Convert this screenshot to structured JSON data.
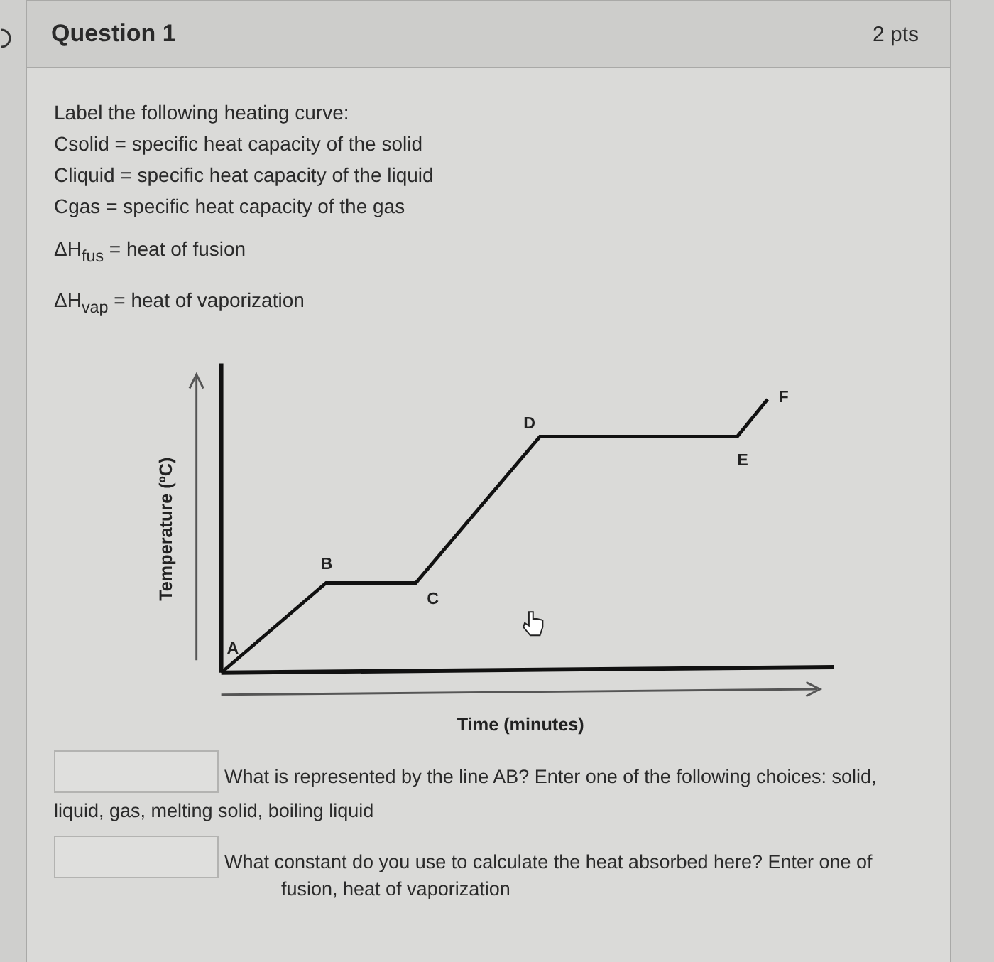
{
  "question": {
    "title": "Question 1",
    "points": "2 pts"
  },
  "intro_lines": [
    "Label the following heating curve:",
    "Csolid = specific heat capacity of the solid",
    "Cliquid = specific heat capacity of the liquid",
    "Cgas = specific heat capacity of the gas"
  ],
  "definitions": [
    "ΔH$_{fus}$ = heat of fusion",
    "ΔH$_{vap}$ = heat of vaporization"
  ],
  "diagram": {
    "y_axis_label": "Temperature (ºC)",
    "x_axis_label": "Time (minutes)",
    "point_labels": [
      "A",
      "B",
      "C",
      "D",
      "E",
      "F"
    ]
  },
  "answers": [
    {
      "prompt": "What is represented by the line AB? Enter one of the following choices: solid,",
      "continuation": "liquid, gas, melting solid, boiling liquid"
    },
    {
      "prompt": "What constant do you use to calculate the heat absorbed here?  Enter one of"
    }
  ],
  "partial_line": "fusion, heat of vaporization"
}
